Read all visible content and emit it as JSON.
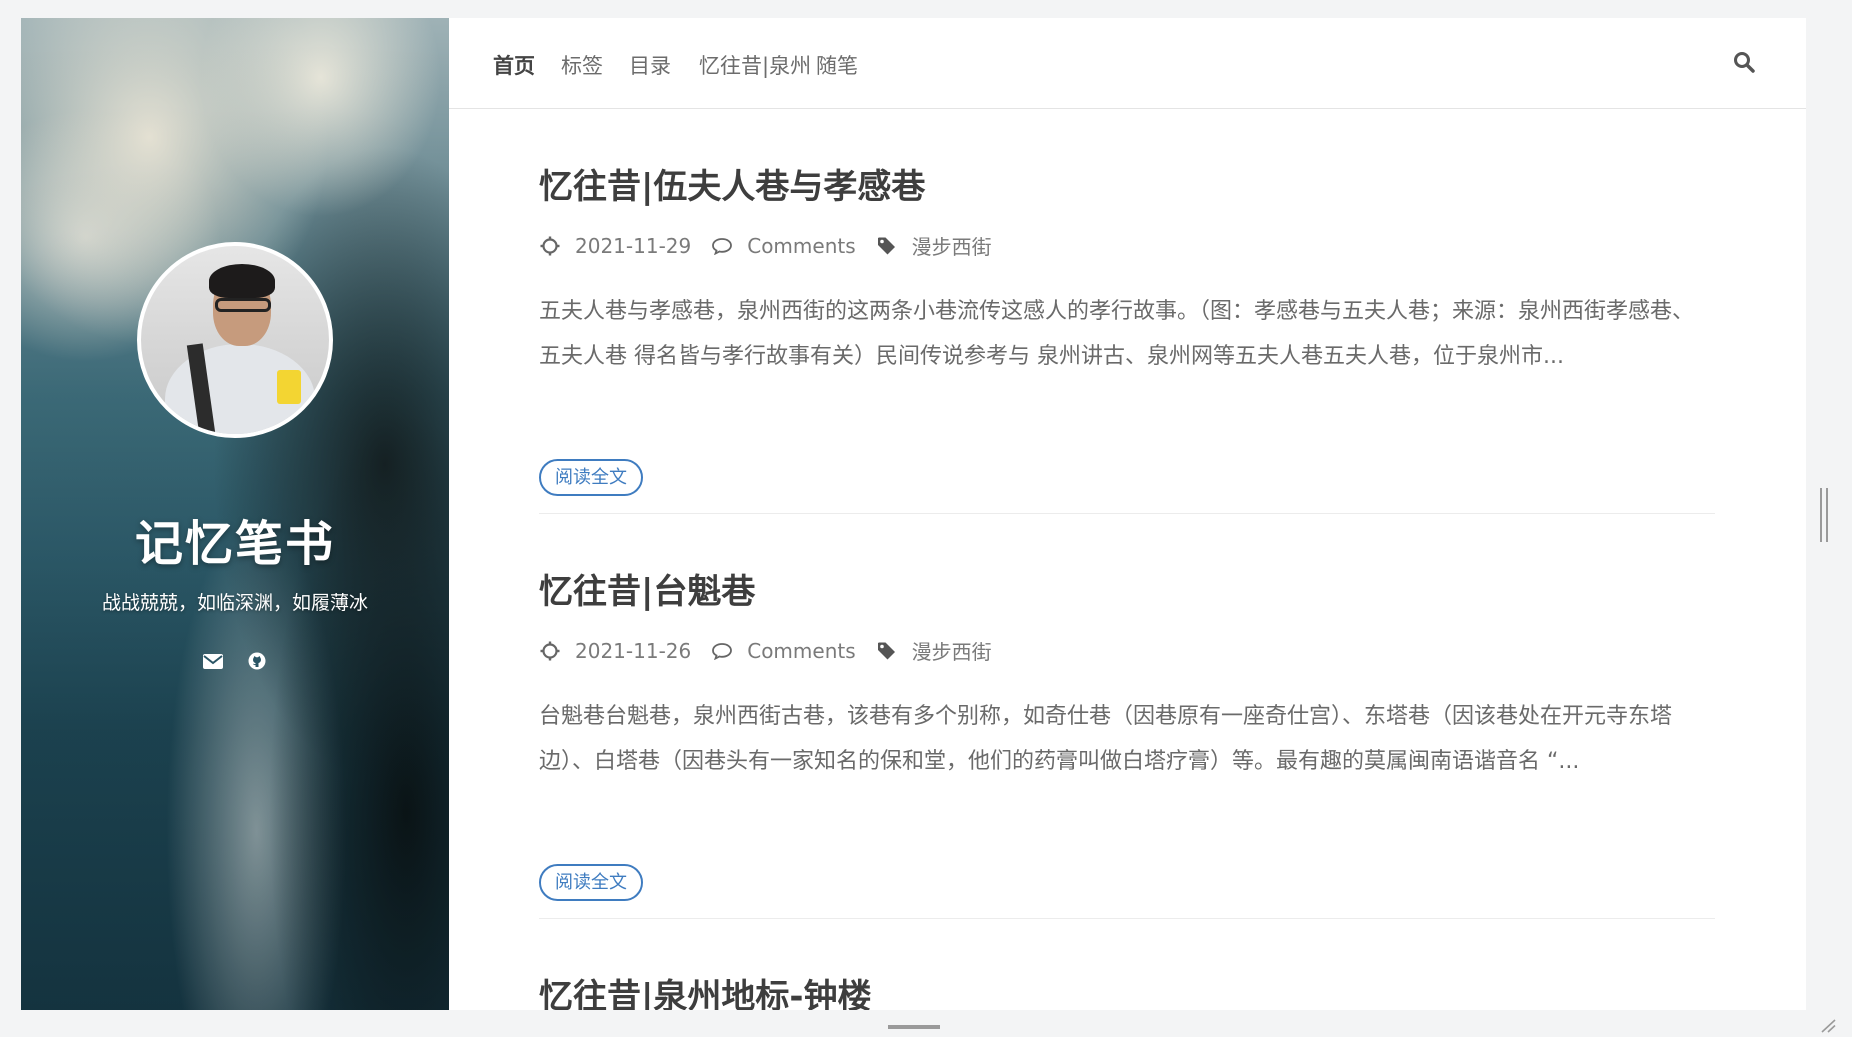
{
  "site": {
    "title": "记忆笔书",
    "subtitle": "战战兢兢，如临深渊，如履薄冰",
    "social": [
      "envelope-icon",
      "github-icon"
    ]
  },
  "nav": {
    "items": [
      "首页",
      "标签",
      "目录",
      "忆往昔|泉州",
      "随笔"
    ],
    "active": "首页"
  },
  "posts": [
    {
      "title": "忆往昔|伍夫人巷与孝感巷",
      "date": "2021-11-29",
      "comments": "Comments",
      "tag": "漫步西街",
      "excerpt": "五夫人巷与孝感巷，泉州西街的这两条小巷流传这感人的孝行故事。（图：孝感巷与五夫人巷；来源：泉州西街孝感巷、五夫人巷 得名皆与孝行故事有关）民间传说参考与 泉州讲古、泉州网等五夫人巷五夫人巷，位于泉州市...",
      "read_more": "阅读全文"
    },
    {
      "title": "忆往昔|台魁巷",
      "date": "2021-11-26",
      "comments": "Comments",
      "tag": "漫步西街",
      "excerpt": "台魁巷台魁巷，泉州西街古巷，该巷有多个别称，如奇仕巷（因巷原有一座奇仕宫）、东塔巷（因该巷处在开元寺东塔边）、白塔巷（因巷头有一家知名的保和堂，他们的药膏叫做白塔疗膏）等。最有趣的莫属闽南语谐音名 “...",
      "read_more": "阅读全文"
    },
    {
      "title": "忆往昔|泉州地标-钟楼"
    }
  ],
  "colors": {
    "accent": "#3f7cc0",
    "title": "#3e3e3e",
    "text": "#6a6a6a"
  }
}
